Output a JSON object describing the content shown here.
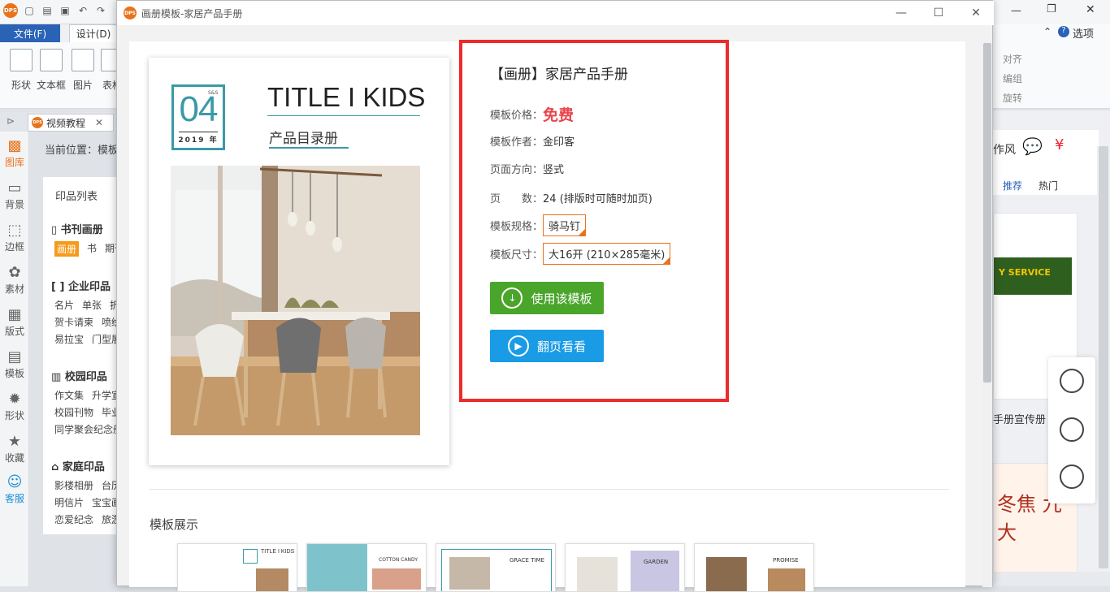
{
  "app": {
    "file_tab": "文件(F)",
    "design_tab": "设计(D)",
    "ribbon_buttons": [
      "形状",
      "文本框",
      "图片",
      "表格"
    ],
    "doc_tab": "视频教程",
    "location": "当前位置：模板",
    "sidebar": [
      "图库",
      "背景",
      "边框",
      "素材",
      "版式",
      "模板",
      "形状",
      "收藏",
      "客服"
    ],
    "left_panel": {
      "head": "印品列表",
      "sections": [
        {
          "title": "书刊画册",
          "rows": [
            [
              "画册",
              "书",
              "期刊"
            ]
          ]
        },
        {
          "title": "企业印品",
          "rows": [
            [
              "名片",
              "单张",
              "折页"
            ],
            [
              "贺卡请柬",
              "喷绘"
            ],
            [
              "易拉宝",
              "门型展"
            ]
          ]
        },
        {
          "title": "校园印品",
          "rows": [
            [
              "作文集",
              "升学宣"
            ],
            [
              "校园刊物",
              "毕业"
            ],
            [
              "同学聚会纪念册"
            ]
          ]
        },
        {
          "title": "家庭印品",
          "rows": [
            [
              "影楼相册",
              "台历"
            ],
            [
              "明信片",
              "宝宝画"
            ],
            [
              "恋爱纪念",
              "旅游"
            ]
          ]
        }
      ]
    },
    "right": {
      "options": "选项",
      "align": "对齐",
      "group": "编组",
      "rotate": "旋转",
      "style_text": "作风",
      "tab_recommend": "推荐",
      "tab_hot": "热门",
      "service_text": "Y SERVICE",
      "card_caption": "手册宣传册",
      "card2_text": "冬焦 九大"
    }
  },
  "modal": {
    "title": "画册模板-家居产品手册",
    "cover": {
      "number": "04",
      "ss": "S&S",
      "year": "2019 年",
      "title": "TITLE I KIDS",
      "subtitle": "产品目录册"
    },
    "info": {
      "name": "【画册】家居产品手册",
      "price_label": "模板价格：",
      "price_value": "免费",
      "author_label": "模板作者：",
      "author_value": "金印客",
      "orientation_label": "页面方向：",
      "orientation_value": "竖式",
      "pages_label": "页　　数：",
      "pages_value": "24 (排版时可随时加页)",
      "spec_label": "模板规格：",
      "spec_value": "骑马钉",
      "size_label": "模板尺寸：",
      "size_value": "大16开 (210×285毫米)",
      "use_button": "使用该模板",
      "flip_button": "翻页看看"
    },
    "showcase_title": "模板展示",
    "thumbs": [
      "TITLE I KIDS",
      "COTTON CANDY",
      "GRACE TIME",
      "GARDEN",
      "PROMISE"
    ]
  },
  "colors": {
    "accent_orange": "#e8731c",
    "highlight_red": "#ec2b2b",
    "use_green": "#4aa52b",
    "flip_blue": "#1a9be6",
    "teal": "#3a9aa6"
  }
}
